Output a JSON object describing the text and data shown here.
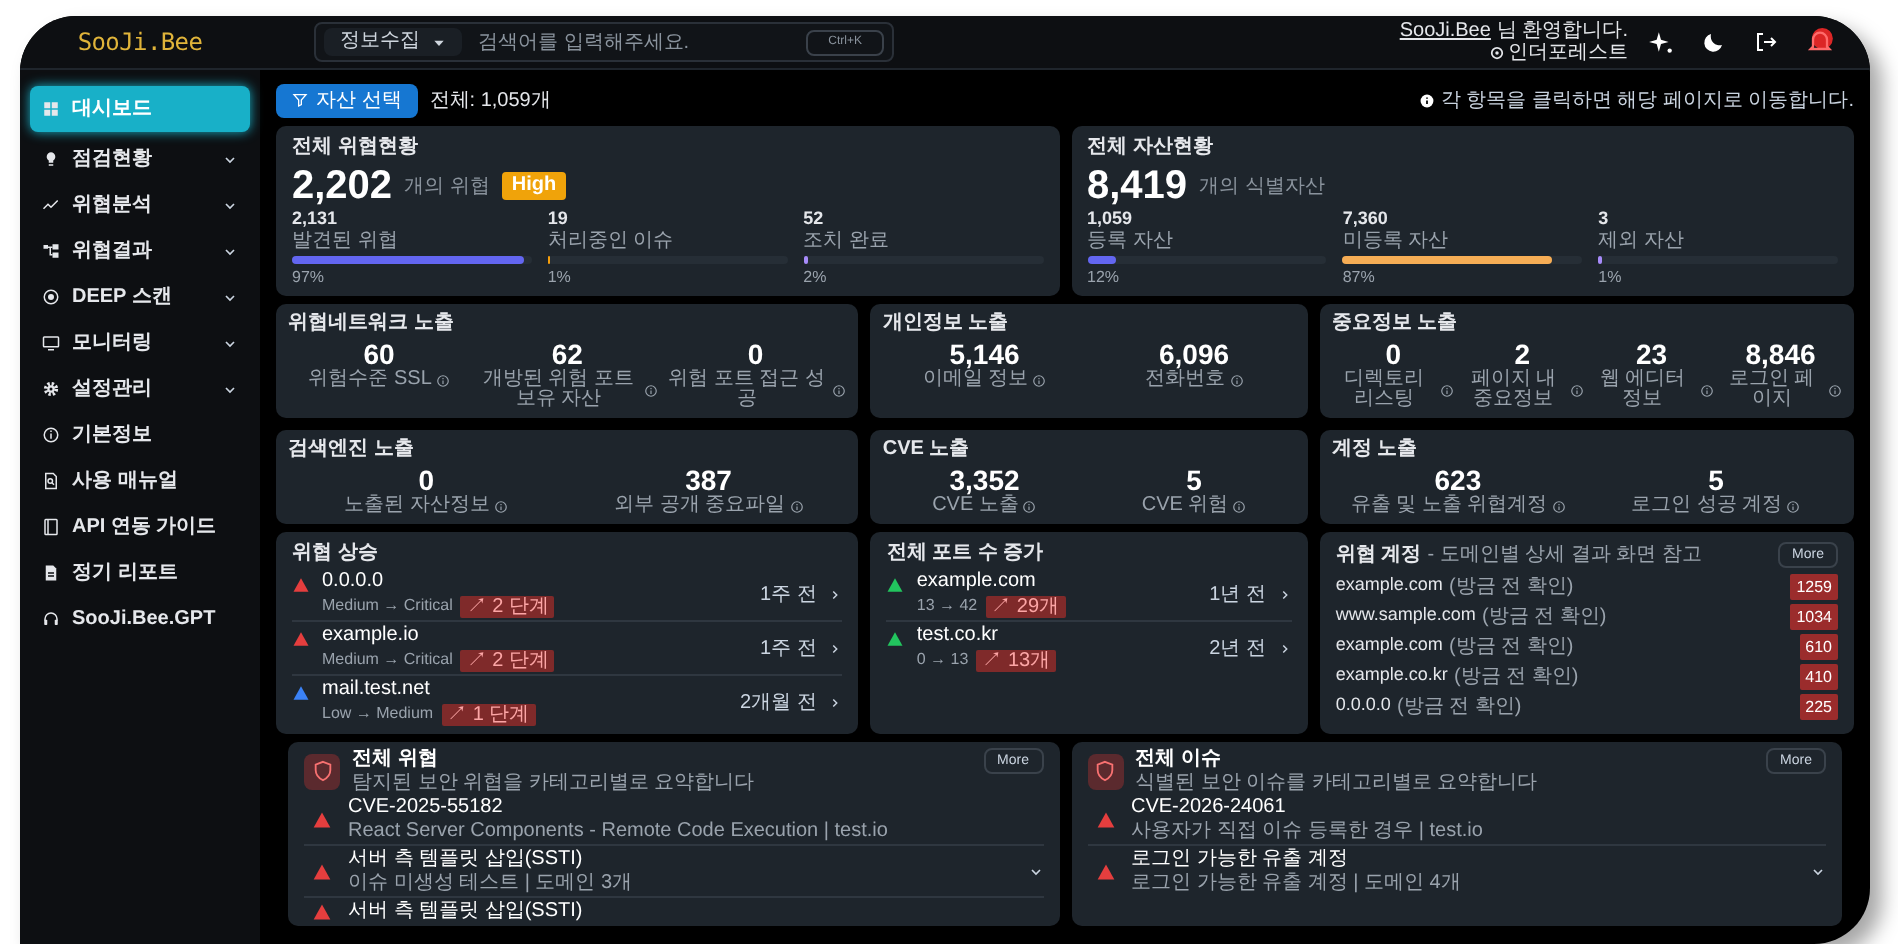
{
  "header": {
    "logo": "SooJi.Bee",
    "search": {
      "scope": "정보수집",
      "placeholder": "검색어를 입력해주세요.",
      "shortcut": "Ctrl+K"
    },
    "user": {
      "name": "SooJi.Bee",
      "greeting": "님 환영합니다.",
      "org": "인더포레스트"
    },
    "notification": {
      "alert": true
    }
  },
  "sidebar": {
    "items": [
      {
        "label": "대시보드",
        "expandable": false,
        "selected": true
      },
      {
        "label": "점검현황",
        "expandable": true,
        "selected": false
      },
      {
        "label": "위협분석",
        "expandable": true,
        "selected": false
      },
      {
        "label": "위협결과",
        "expandable": true,
        "selected": false
      },
      {
        "label": "DEEP 스캔",
        "expandable": true,
        "selected": false
      },
      {
        "label": "모니터링",
        "expandable": true,
        "selected": false
      },
      {
        "label": "설정관리",
        "expandable": true,
        "selected": false
      },
      {
        "label": "기본정보",
        "expandable": false,
        "selected": false
      },
      {
        "label": "사용 매뉴얼",
        "expandable": false,
        "selected": false
      },
      {
        "label": "API 연동 가이드",
        "expandable": false,
        "selected": false
      },
      {
        "label": "정기 리포트",
        "expandable": false,
        "selected": false
      },
      {
        "label": "SooJi.Bee.GPT",
        "expandable": false,
        "selected": false
      }
    ]
  },
  "toolbar": {
    "asset_button": "자산 선택",
    "total": "전체: 1,059개",
    "hint": "각 항목을 클릭하면 해당 페이지로 이동합니다."
  },
  "summary_cards": [
    {
      "title": "전체 위협현황",
      "total": "2,202",
      "unit": "개의 위협",
      "badge": "High",
      "metrics": [
        {
          "value": "2,131",
          "label": "발견된 위협",
          "level": 0.97,
          "percent": "97%",
          "color": "#6366f1"
        },
        {
          "value": "19",
          "label": "처리중인 이슈",
          "level": 0.01,
          "percent": "1%",
          "color": "#f59e0b"
        },
        {
          "value": "52",
          "label": "조치 완료",
          "level": 0.02,
          "percent": "2%",
          "color": "#a78bfa"
        }
      ]
    },
    {
      "title": "전체 자산현황",
      "total": "8,419",
      "unit": "개의 식별자산",
      "metrics": [
        {
          "value": "1,059",
          "label": "등록 자산",
          "level": 0.12,
          "percent": "12%",
          "color": "#6366f1"
        },
        {
          "value": "7,360",
          "label": "미등록 자산",
          "level": 0.87,
          "percent": "87%",
          "color": "#f6ad55"
        },
        {
          "value": "3",
          "label": "제외 자산",
          "level": 0.01,
          "percent": "1%",
          "color": "#a78bfa"
        }
      ]
    }
  ],
  "stat_cards": [
    {
      "title": "위협네트워크 노출",
      "stats": [
        {
          "value": "60",
          "label": "위험수준 SSL"
        },
        {
          "value": "62",
          "label": "개방된 위험 포트 보유 자산"
        },
        {
          "value": "0",
          "label": "위험 포트 접근 성공"
        }
      ]
    },
    {
      "title": "개인정보 노출",
      "stats": [
        {
          "value": "5,146",
          "label": "이메일 정보"
        },
        {
          "value": "6,096",
          "label": "전화번호"
        }
      ]
    },
    {
      "title": "중요정보 노출",
      "stats": [
        {
          "value": "0",
          "label": "디렉토리 리스팅"
        },
        {
          "value": "2",
          "label": "페이지 내 중요정보"
        },
        {
          "value": "23",
          "label": "웹 에디터 정보"
        },
        {
          "value": "8,846",
          "label": "로그인 페이지"
        }
      ]
    },
    {
      "title": "검색엔진 노출",
      "stats": [
        {
          "value": "0",
          "label": "노출된 자산정보"
        },
        {
          "value": "387",
          "label": "외부 공개 중요파일"
        }
      ]
    },
    {
      "title": "CVE 노출",
      "stats": [
        {
          "value": "3,352",
          "label": "CVE 노출"
        },
        {
          "value": "5",
          "label": "CVE 위험"
        }
      ]
    },
    {
      "title": "계정 노출",
      "stats": [
        {
          "value": "623",
          "label": "유출 및 노출 위협계정"
        },
        {
          "value": "5",
          "label": "로그인 성공 계정"
        }
      ]
    }
  ],
  "risk_rise": {
    "title": "위협 상승",
    "items": [
      {
        "target": "0.0.0.0",
        "change": "Medium → Critical",
        "delta": "↗ 2 단계",
        "time": "1주 전",
        "color": "#e53e3e"
      },
      {
        "target": "example.io",
        "change": "Medium → Critical",
        "delta": "↗ 2 단계",
        "time": "1주 전",
        "color": "#e53e3e"
      },
      {
        "target": "mail.test.net",
        "change": "Low → Medium",
        "delta": "↗ 1 단계",
        "time": "2개월 전",
        "color": "#3b82f6"
      }
    ]
  },
  "port_rise": {
    "title": "전체 포트 수 증가",
    "items": [
      {
        "target": "example.com",
        "change": "13 → 42",
        "delta": "↗ 29개",
        "time": "1년 전",
        "color": "#22c55e"
      },
      {
        "target": "test.co.kr",
        "change": "0 → 13",
        "delta": "↗ 13개",
        "time": "2년 전",
        "color": "#22c55e"
      }
    ]
  },
  "threat_accounts": {
    "title": "위협 계정",
    "subtitle": "- 도메인별 상세 결과 화면 참고",
    "more": "More",
    "rows": [
      {
        "domain": "example.com",
        "note": "(방금 전 확인)",
        "count": "1259"
      },
      {
        "domain": "www.sample.com",
        "note": "(방금 전 확인)",
        "count": "1034"
      },
      {
        "domain": "example.com",
        "note": "(방금 전 확인)",
        "count": "610"
      },
      {
        "domain": "example.co.kr",
        "note": "(방금 전 확인)",
        "count": "410"
      },
      {
        "domain": "0.0.0.0",
        "note": "(방금 전 확인)",
        "count": "225"
      }
    ]
  },
  "summaries": [
    {
      "title": "전체 위협",
      "subtitle": "탐지된 보안 위협을 카테고리별로 요약합니다",
      "more": "More",
      "items": [
        {
          "title": "CVE-2025-55182",
          "sub": "React Server Components - Remote Code Execution | test.io",
          "expandable": false
        },
        {
          "title": "서버 측 템플릿 삽입(SSTI)",
          "sub": "이슈 미생성 테스트 | 도메인 3개",
          "expandable": true
        },
        {
          "title": "서버 측 템플릿 삽입(SSTI)",
          "expandable": false
        }
      ]
    },
    {
      "title": "전체 이슈",
      "subtitle": "식별된 보안 이슈를 카테고리별로 요약합니다",
      "more": "More",
      "items": [
        {
          "title": "CVE-2026-24061",
          "sub": "사용자가 직접 이슈 등록한 경우 | test.io",
          "expandable": false
        },
        {
          "title": "로그인 가능한 유출 계정",
          "sub": "로그인 가능한 유출 계정 | 도메인 4개",
          "expandable": true
        }
      ]
    }
  ]
}
